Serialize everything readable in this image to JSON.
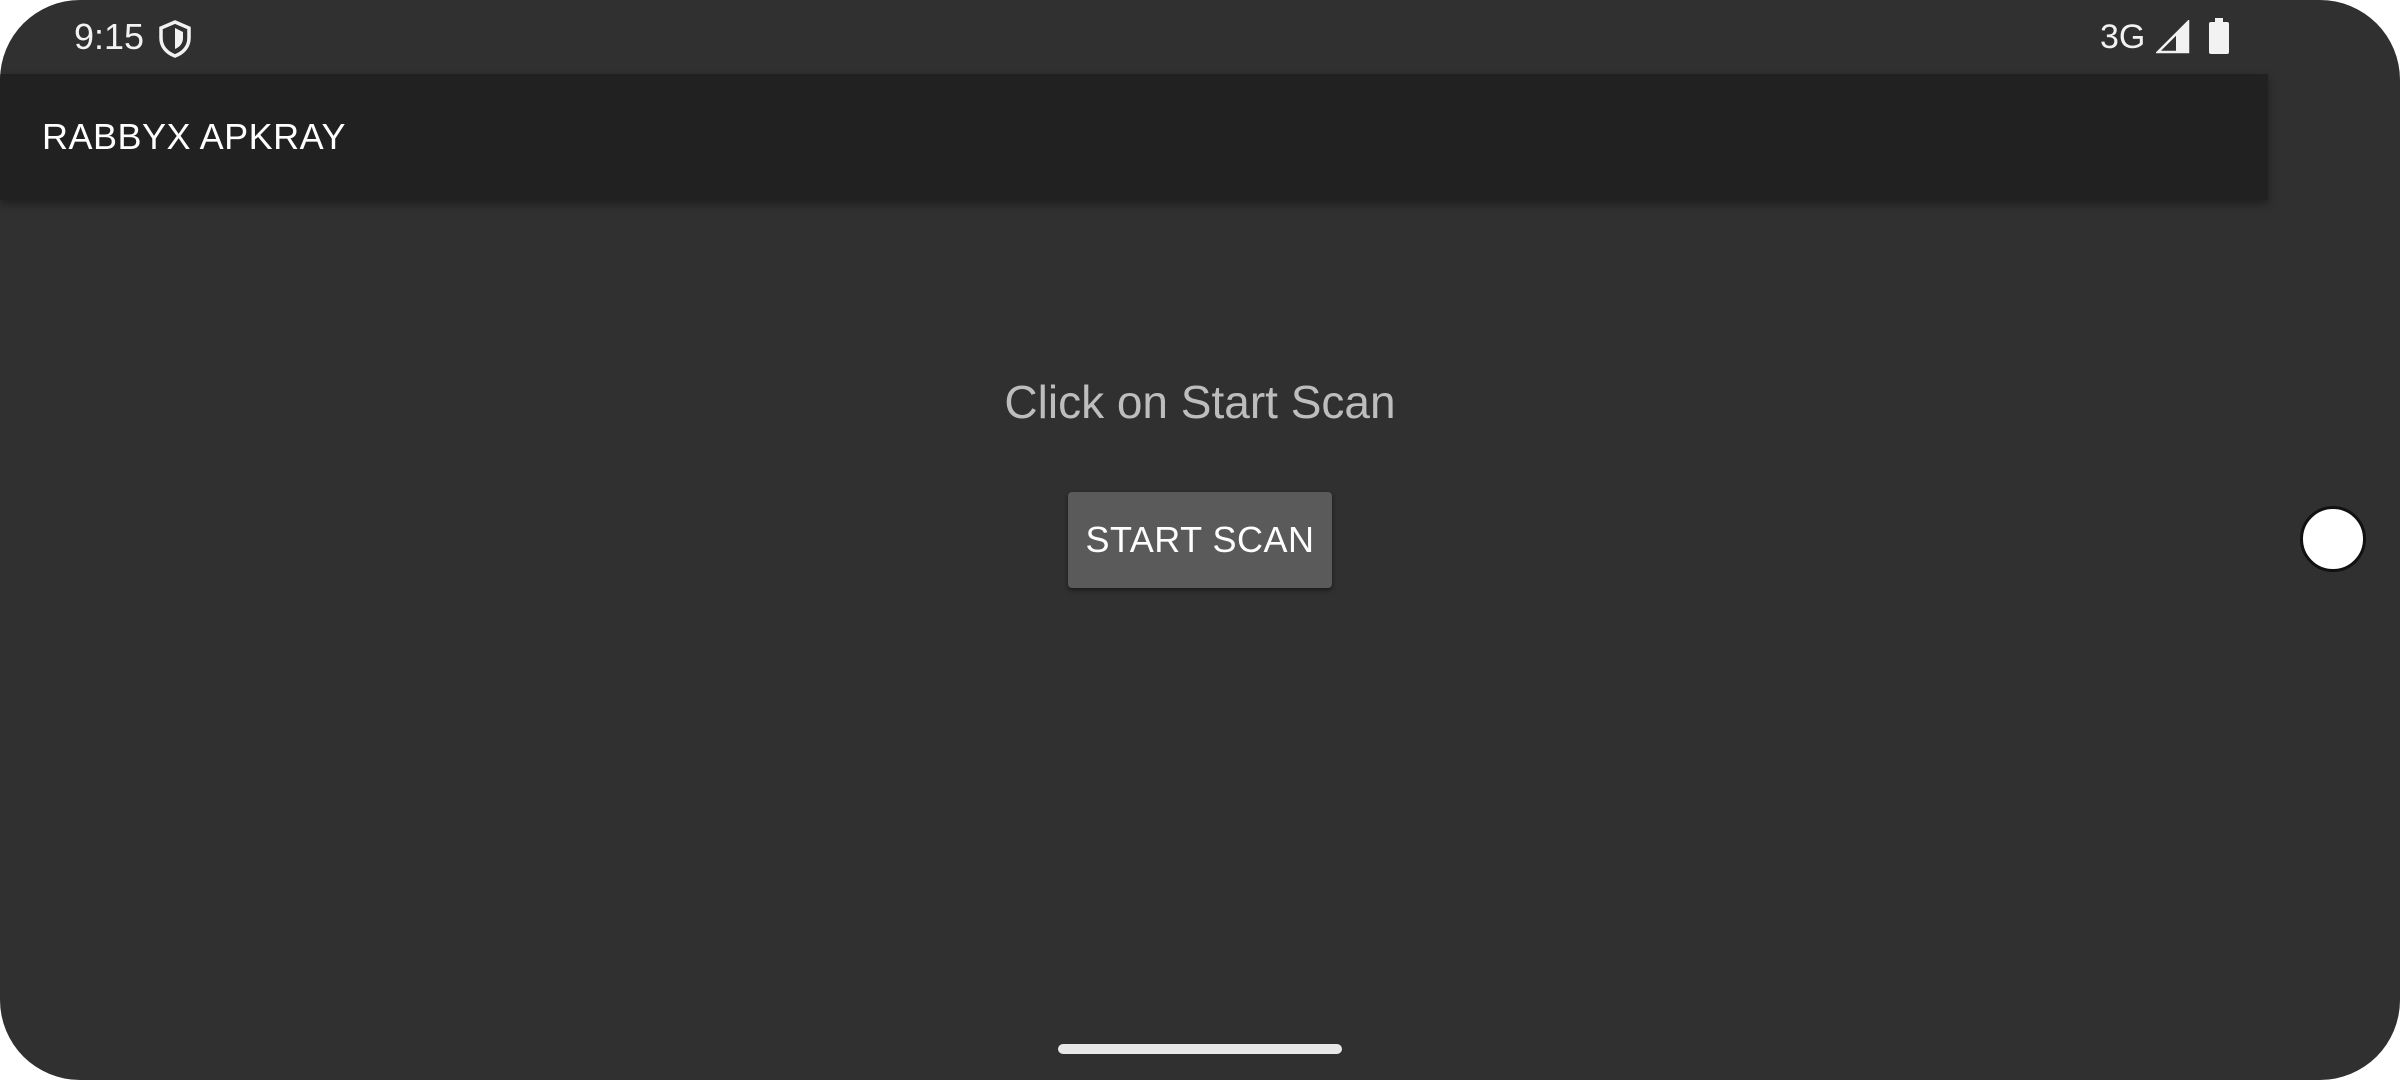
{
  "status_bar": {
    "time": "9:15",
    "network": "3G",
    "icons": [
      "shield-icon",
      "signal-icon",
      "battery-icon"
    ]
  },
  "app_bar": {
    "title": "RABBYX APKRAY"
  },
  "main": {
    "instruction": "Click on Start Scan",
    "start_button_label": "START SCAN"
  },
  "colors": {
    "background": "#303030",
    "app_bar": "#212121",
    "button": "#5a5a5a",
    "instruction_text": "#bdbdbd"
  }
}
